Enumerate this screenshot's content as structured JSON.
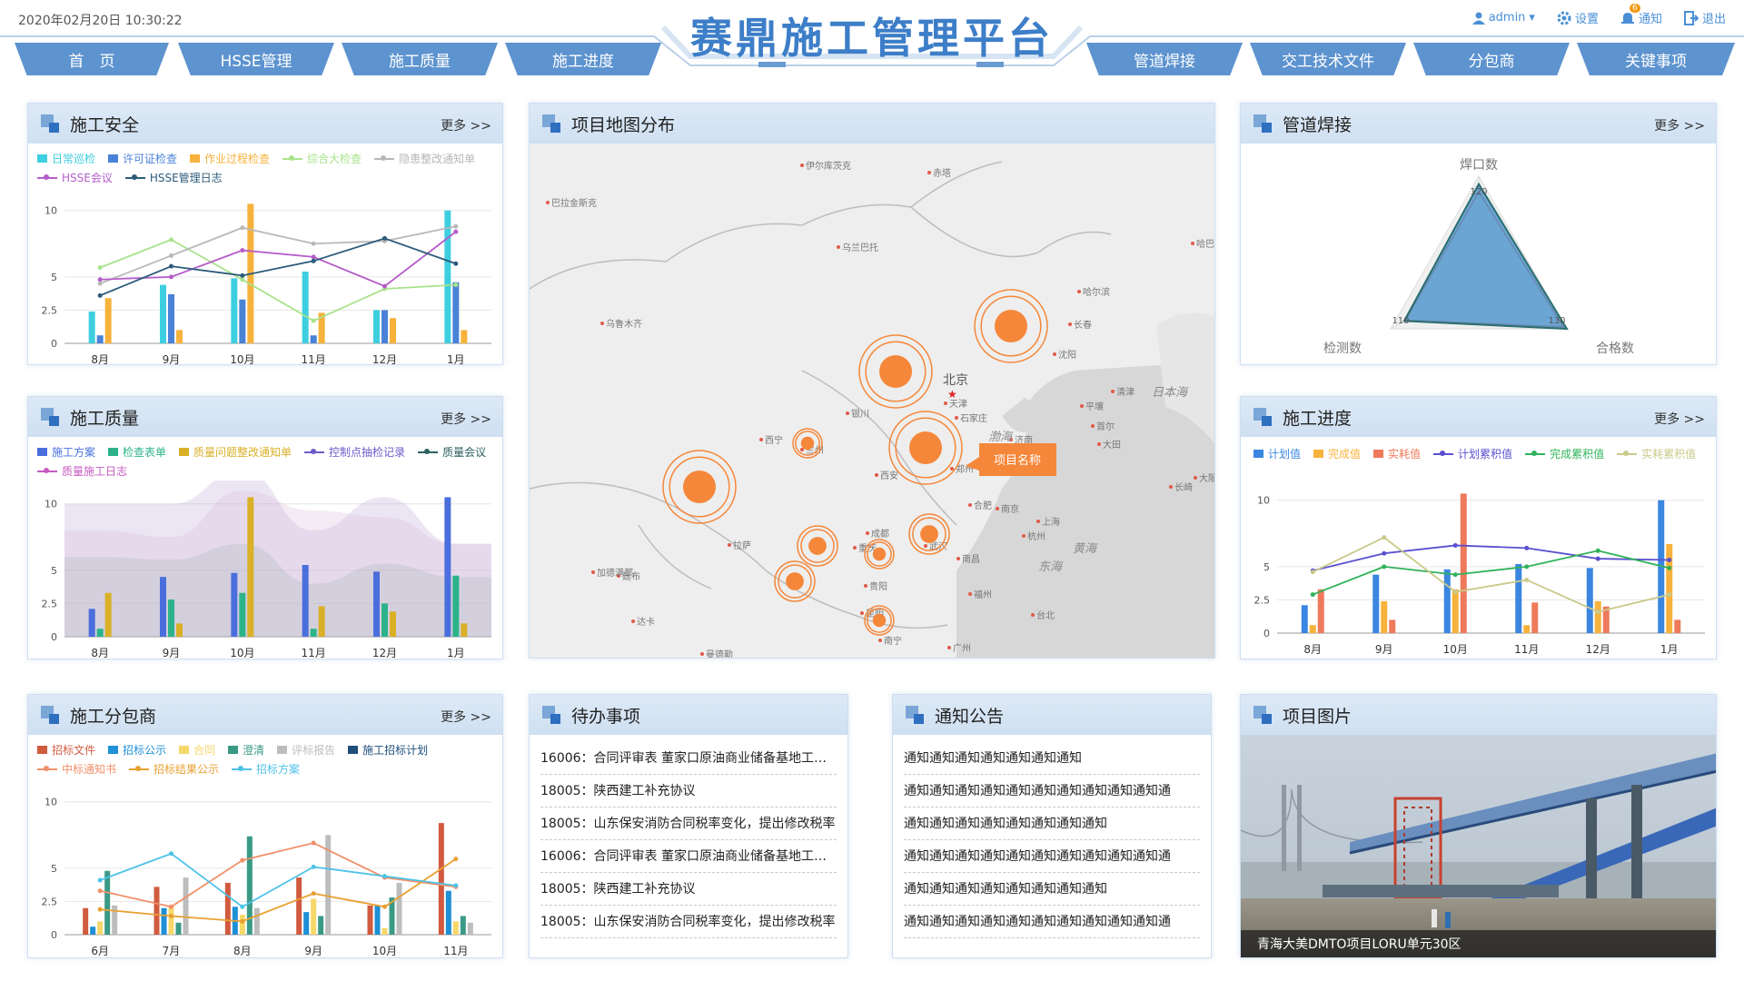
{
  "header": {
    "datetime": "2020年02月20日 10:30:22",
    "title": "赛鼎施工管理平台",
    "user": "admin",
    "settings_label": "设置",
    "notify_label": "通知",
    "notify_badge": "6",
    "logout_label": "退出"
  },
  "nav": {
    "left": [
      "首　页",
      "HSSE管理",
      "施工质量",
      "施工进度"
    ],
    "right": [
      "管道焊接",
      "交工技术文件",
      "分包商",
      "关键事项"
    ]
  },
  "common": {
    "more": "更多  >>"
  },
  "safety": {
    "title": "施工安全",
    "legend": [
      {
        "name": "日常巡检",
        "color": "#3dcfdf",
        "kind": "bar"
      },
      {
        "name": "许可证检查",
        "color": "#4a82d8",
        "kind": "bar"
      },
      {
        "name": "作业过程检查",
        "color": "#f7b23b",
        "kind": "bar"
      },
      {
        "name": "综合大检查",
        "color": "#a8e38c",
        "kind": "line"
      },
      {
        "name": "隐患整改通知单",
        "color": "#b8b8b8",
        "kind": "line"
      },
      {
        "name": "HSSE会议",
        "color": "#b55dc9",
        "kind": "line"
      },
      {
        "name": "HSSE管理日志",
        "color": "#2c5b7a",
        "kind": "line"
      }
    ]
  },
  "quality": {
    "title": "施工质量",
    "legend": [
      {
        "name": "施工方案",
        "color": "#4a6fdc",
        "kind": "bar"
      },
      {
        "name": "检查表单",
        "color": "#2cb38a",
        "kind": "bar"
      },
      {
        "name": "质量问题整改通知单",
        "color": "#d9b027",
        "kind": "bar"
      },
      {
        "name": "控制点抽检记录",
        "color": "#6a5cc7",
        "kind": "line"
      },
      {
        "name": "质量会议",
        "color": "#2d6060",
        "kind": "line"
      },
      {
        "name": "质量施工日志",
        "color": "#c55bc0",
        "kind": "line"
      }
    ]
  },
  "subcontract": {
    "title": "施工分包商",
    "legend": [
      {
        "name": "招标文件",
        "color": "#d15a3f",
        "kind": "bar"
      },
      {
        "name": "招标公示",
        "color": "#1f8fd6",
        "kind": "bar"
      },
      {
        "name": "合同",
        "color": "#f6d86a",
        "kind": "bar"
      },
      {
        "name": "澄清",
        "color": "#3a9a86",
        "kind": "bar"
      },
      {
        "name": "评标报告",
        "color": "#bdbdbd",
        "kind": "bar"
      },
      {
        "name": "施工招标计划",
        "color": "#1f4e7a",
        "kind": "bar"
      },
      {
        "name": "中标通知书",
        "color": "#f0906a",
        "kind": "line"
      },
      {
        "name": "招标结果公示",
        "color": "#e8a030",
        "kind": "line"
      },
      {
        "name": "招标方案",
        "color": "#4ec2e8",
        "kind": "line"
      }
    ]
  },
  "map": {
    "title": "项目地图分布",
    "callout": "项目名称",
    "capital": "北京",
    "cities": [
      {
        "n": "伊尔库茨克"
      },
      {
        "n": "赤塔"
      },
      {
        "n": "巴拉金斯克"
      },
      {
        "n": "乌兰巴托"
      },
      {
        "n": "哈尔滨"
      },
      {
        "n": "乌鲁木齐"
      },
      {
        "n": "长春"
      },
      {
        "n": "沈阳"
      },
      {
        "n": "天津"
      },
      {
        "n": "银川"
      },
      {
        "n": "石家庄"
      },
      {
        "n": "平壤"
      },
      {
        "n": "首尔"
      },
      {
        "n": "西宁"
      },
      {
        "n": "兰州"
      },
      {
        "n": "济南"
      },
      {
        "n": "大田"
      },
      {
        "n": "郑州"
      },
      {
        "n": "西安"
      },
      {
        "n": "合肥"
      },
      {
        "n": "南京"
      },
      {
        "n": "上海"
      },
      {
        "n": "杭州"
      },
      {
        "n": "拉萨"
      },
      {
        "n": "成都"
      },
      {
        "n": "重庆"
      },
      {
        "n": "武汉"
      },
      {
        "n": "南昌"
      },
      {
        "n": "贵阳"
      },
      {
        "n": "昆明"
      },
      {
        "n": "福州"
      },
      {
        "n": "台北"
      },
      {
        "n": "南宁"
      },
      {
        "n": "广州"
      },
      {
        "n": "香港"
      },
      {
        "n": "廷布"
      },
      {
        "n": "加德满都"
      },
      {
        "n": "达卡"
      },
      {
        "n": "曼德勒"
      },
      {
        "n": "清津"
      },
      {
        "n": "哈巴"
      },
      {
        "n": "长崎"
      },
      {
        "n": "大阪"
      }
    ],
    "seas": [
      "渤海",
      "日本海",
      "黄海",
      "东海"
    ]
  },
  "weld": {
    "title": "管道焊接",
    "indicators": [
      "焊口数",
      "合格数",
      "检测数"
    ],
    "ticks": [
      "120",
      "130",
      "110"
    ]
  },
  "progress": {
    "title": "施工进度",
    "legend": [
      {
        "name": "计划值",
        "color": "#3a86e0",
        "kind": "bar"
      },
      {
        "name": "完成值",
        "color": "#f7b23b",
        "kind": "bar"
      },
      {
        "name": "实耗值",
        "color": "#ee7a5b",
        "kind": "bar"
      },
      {
        "name": "计划累积值",
        "color": "#5a4fcf",
        "kind": "line"
      },
      {
        "name": "完成累积值",
        "color": "#2fb35a",
        "kind": "line"
      },
      {
        "name": "实耗累积值",
        "color": "#c9c98a",
        "kind": "line"
      }
    ]
  },
  "todo": {
    "title": "待办事项",
    "items": [
      "16006：合同评审表  董家口原油商业储备基地工程...",
      "18005：陕西建工补充协议",
      "18005：山东保安消防合同税率变化，提出修改税率",
      "16006：合同评审表  董家口原油商业储备基地工程...",
      "18005：陕西建工补充协议",
      "18005：山东保安消防合同税率变化，提出修改税率"
    ]
  },
  "notice": {
    "title": "通知公告",
    "items": [
      "通知通知通知通知通知通知通知",
      "通知通知通知通知通知通知通知通知通知通知通",
      "通知通知通知通知通知通知通知通知",
      "通知通知通知通知通知通知通知通知通知通知通",
      "通知通知通知通知通知通知通知通知",
      "通知通知通知通知通知通知通知通知通知通知通"
    ]
  },
  "photo": {
    "title": "项目图片",
    "caption": "青海大美DMTO项目LORU单元30区"
  },
  "chart_data": [
    {
      "id": "safety",
      "type": "bar",
      "categories": [
        "8月",
        "9月",
        "10月",
        "11月",
        "12月",
        "1月"
      ],
      "ylim": [
        0,
        10
      ],
      "yticks": [
        "0",
        "2.5",
        "5",
        "10"
      ],
      "series": [
        {
          "name": "日常巡检",
          "kind": "bar",
          "values": [
            2.4,
            4.4,
            4.9,
            5.4,
            2.5,
            10
          ]
        },
        {
          "name": "许可证检查",
          "kind": "bar",
          "values": [
            0.6,
            3.7,
            3.3,
            0.6,
            2.5,
            4.6
          ]
        },
        {
          "name": "作业过程检查",
          "kind": "bar",
          "values": [
            3.4,
            1.0,
            10.5,
            2.3,
            1.9,
            1.0
          ]
        },
        {
          "name": "综合大检查",
          "kind": "line",
          "values": [
            5.7,
            7.8,
            4.8,
            1.7,
            4.1,
            4.4
          ]
        },
        {
          "name": "隐患整改通知单",
          "kind": "line",
          "values": [
            4.5,
            6.6,
            8.7,
            7.5,
            7.7,
            8.8
          ]
        },
        {
          "name": "HSSE会议",
          "kind": "line",
          "values": [
            4.8,
            5.0,
            7.0,
            6.5,
            4.3,
            8.4
          ]
        },
        {
          "name": "HSSE管理日志",
          "kind": "line",
          "values": [
            3.6,
            5.8,
            5.1,
            6.2,
            7.9,
            6.0
          ]
        }
      ]
    },
    {
      "id": "quality",
      "type": "bar",
      "categories": [
        "8月",
        "9月",
        "10月",
        "11月",
        "12月",
        "1月"
      ],
      "ylim": [
        0,
        10
      ],
      "yticks": [
        "0",
        "2.5",
        "5",
        "10"
      ],
      "series": [
        {
          "name": "施工方案",
          "kind": "bar",
          "values": [
            2.1,
            4.5,
            4.8,
            5.4,
            4.9,
            10.5
          ]
        },
        {
          "name": "检查表单",
          "kind": "bar",
          "values": [
            0.6,
            2.8,
            3.3,
            0.6,
            2.5,
            4.6
          ]
        },
        {
          "name": "质量问题整改通知单",
          "kind": "bar",
          "values": [
            3.3,
            1.0,
            10.5,
            2.3,
            1.9,
            1.0
          ]
        },
        {
          "name": "控制点抽检记录",
          "kind": "area",
          "values": [
            10,
            10,
            12.5,
            8,
            10.5,
            7
          ]
        },
        {
          "name": "质量会议",
          "kind": "area",
          "values": [
            6,
            5.8,
            7,
            4,
            5.5,
            4.5
          ]
        },
        {
          "name": "质量施工日志",
          "kind": "area",
          "values": [
            8,
            7.5,
            11,
            9.5,
            9,
            7
          ]
        }
      ]
    },
    {
      "id": "subcontract",
      "type": "bar",
      "categories": [
        "6月",
        "7月",
        "8月",
        "9月",
        "10月",
        "11月"
      ],
      "ylim": [
        0,
        10
      ],
      "yticks": [
        "0",
        "2.5",
        "5",
        "10"
      ],
      "series": [
        {
          "name": "招标文件",
          "kind": "bar",
          "values": [
            2.0,
            3.6,
            3.9,
            4.3,
            2.2,
            8.4
          ]
        },
        {
          "name": "招标公示",
          "kind": "bar",
          "values": [
            0.6,
            2.0,
            2.1,
            1.7,
            2.2,
            3.3
          ]
        },
        {
          "name": "合同",
          "kind": "bar",
          "values": [
            1.0,
            2.2,
            1.5,
            2.7,
            0.5,
            1.0
          ]
        },
        {
          "name": "澄清",
          "kind": "bar",
          "values": [
            4.8,
            0.9,
            7.4,
            1.4,
            2.8,
            1.4
          ]
        },
        {
          "name": "评标报告",
          "kind": "bar",
          "values": [
            2.2,
            4.3,
            2.0,
            7.5,
            3.9,
            0.9
          ]
        },
        {
          "name": "中标通知书",
          "kind": "line",
          "values": [
            3.3,
            2.1,
            5.6,
            6.9,
            4.3,
            3.6
          ]
        },
        {
          "name": "招标结果公示",
          "kind": "line",
          "values": [
            1.9,
            1.4,
            1.0,
            3.1,
            2.1,
            5.7
          ]
        },
        {
          "name": "招标方案",
          "kind": "line",
          "values": [
            4.1,
            6.1,
            2.1,
            5.1,
            4.4,
            3.7
          ]
        }
      ]
    },
    {
      "id": "progress",
      "type": "bar",
      "categories": [
        "8月",
        "9月",
        "10月",
        "11月",
        "12月",
        "1月"
      ],
      "ylim": [
        0,
        10
      ],
      "yticks": [
        "0",
        "2.5",
        "5",
        "10"
      ],
      "series": [
        {
          "name": "计划值",
          "kind": "bar",
          "values": [
            2.1,
            4.4,
            4.8,
            5.2,
            4.9,
            10
          ]
        },
        {
          "name": "完成值",
          "kind": "bar",
          "values": [
            0.6,
            2.4,
            3.3,
            0.6,
            2.4,
            6.7
          ]
        },
        {
          "name": "实耗值",
          "kind": "bar",
          "values": [
            3.3,
            1.0,
            10.5,
            2.3,
            2.0,
            1.0
          ]
        },
        {
          "name": "计划累积值",
          "kind": "line",
          "values": [
            4.7,
            6.0,
            6.6,
            6.4,
            5.6,
            5.5
          ]
        },
        {
          "name": "完成累积值",
          "kind": "line",
          "values": [
            2.9,
            5.0,
            4.4,
            5.0,
            6.2,
            4.9
          ]
        },
        {
          "name": "实耗累积值",
          "kind": "line",
          "values": [
            4.6,
            7.2,
            3.1,
            4.0,
            1.6,
            2.9
          ]
        }
      ]
    },
    {
      "id": "weld",
      "type": "radar",
      "indicators": [
        "焊口数",
        "合格数",
        "检测数"
      ],
      "series": [
        {
          "values": [
            120,
            130,
            110
          ]
        },
        {
          "values": [
            110,
            125,
            108
          ]
        }
      ]
    }
  ]
}
